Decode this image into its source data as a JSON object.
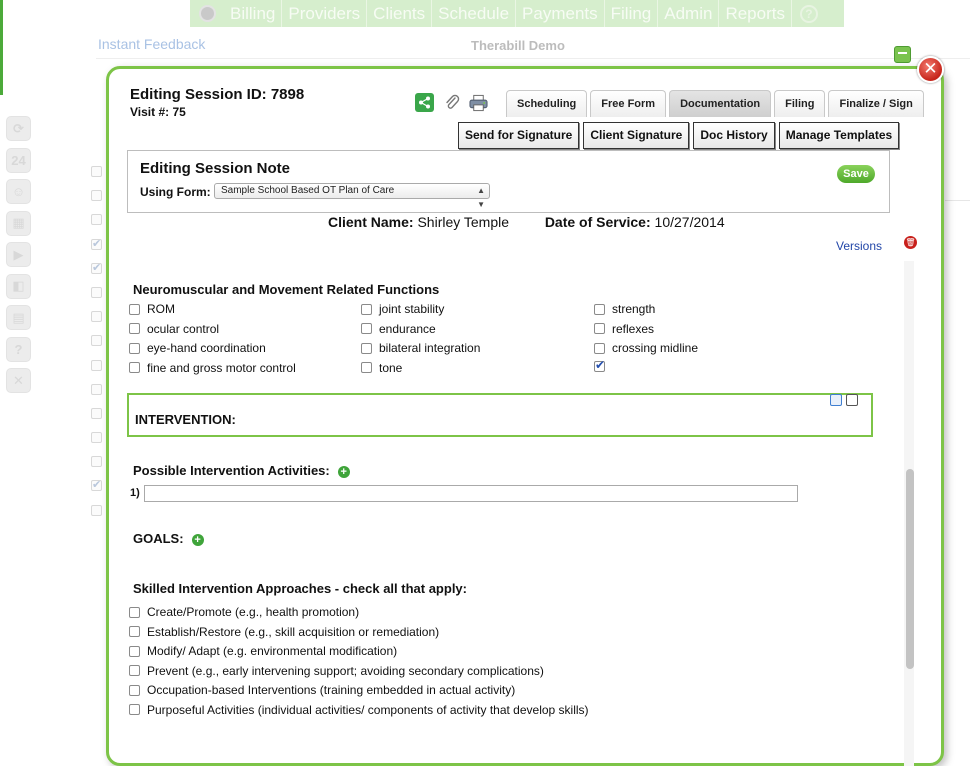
{
  "background": {
    "nav_items": [
      "Billing",
      "Providers",
      "Clients",
      "Schedule",
      "Payments",
      "Filing",
      "Admin",
      "Reports"
    ],
    "help_label": "?",
    "instant_feedback": "Instant Feedback",
    "company_name": "Therabill Demo",
    "sidebar_icons": [
      "dashboard-icon",
      "calendar-icon",
      "clients-icon",
      "schedule-icon",
      "billing-icon",
      "documents-icon",
      "reports-icon",
      "help-icon",
      "close-icon"
    ],
    "sidebar_icon_glyphs": [
      "⟳",
      "24",
      "☺",
      "▦",
      "▶",
      "◧",
      "▤",
      "?",
      "✕"
    ],
    "row_checks": [
      false,
      false,
      false,
      true,
      true,
      false,
      false,
      false,
      false,
      false,
      false,
      false,
      false,
      true,
      false
    ]
  },
  "modal": {
    "title": "Editing Session ID: 7898",
    "visit": "Visit #: 75",
    "close_label": "✕",
    "tabs": [
      {
        "label": "Scheduling",
        "active": false
      },
      {
        "label": "Free Form",
        "active": false
      },
      {
        "label": "Documentation",
        "active": true
      },
      {
        "label": "Filing",
        "active": false
      },
      {
        "label": "Finalize / Sign",
        "active": false
      }
    ],
    "actions": [
      "Send for Signature",
      "Client Signature",
      "Doc History",
      "Manage Templates"
    ],
    "note": {
      "title": "Editing Session Note",
      "using_form_label": "Using Form:",
      "form_value": "Sample School Based OT Plan of Care",
      "save_label": "Save"
    },
    "client_label": "Client Name:",
    "client_value": "Shirley Temple",
    "dos_label": "Date of Service:",
    "dos_value": "10/27/2014",
    "versions_label": "Versions",
    "neuro": {
      "title": "Neuromuscular and Movement Related Functions",
      "columns": [
        [
          {
            "label": "ROM",
            "checked": false
          },
          {
            "label": "ocular control",
            "checked": false
          },
          {
            "label": "eye-hand coordination",
            "checked": false
          },
          {
            "label": "fine and gross motor control",
            "checked": false
          }
        ],
        [
          {
            "label": "joint stability",
            "checked": false
          },
          {
            "label": "endurance",
            "checked": false
          },
          {
            "label": "bilateral integration",
            "checked": false
          },
          {
            "label": "tone",
            "checked": false
          }
        ],
        [
          {
            "label": "strength",
            "checked": false
          },
          {
            "label": "reflexes",
            "checked": false
          },
          {
            "label": "crossing midline",
            "checked": false
          },
          {
            "label": "",
            "checked": true
          }
        ]
      ]
    },
    "intervention_label": "INTERVENTION:",
    "possible_activities_label": "Possible Intervention Activities:",
    "activity_number": "1)",
    "activity_value": "",
    "goals_label": "GOALS:",
    "add_glyph": "+",
    "approaches": {
      "title": "Skilled Intervention Approaches - check all that apply:",
      "items": [
        {
          "label": "Create/Promote (e.g., health promotion)",
          "checked": false
        },
        {
          "label": "Establish/Restore (e.g., skill acquisition or remediation)",
          "checked": false
        },
        {
          "label": "Modify/ Adapt (e.g. environmental modification)",
          "checked": false
        },
        {
          "label": "Prevent (e.g., early intervening support; avoiding secondary complications)",
          "checked": false
        },
        {
          "label": "Occupation-based Interventions (training embedded in actual activity)",
          "checked": false
        },
        {
          "label": "Purposeful Activities (individual activities/ components of activity that develop skills)",
          "checked": false
        }
      ]
    }
  }
}
